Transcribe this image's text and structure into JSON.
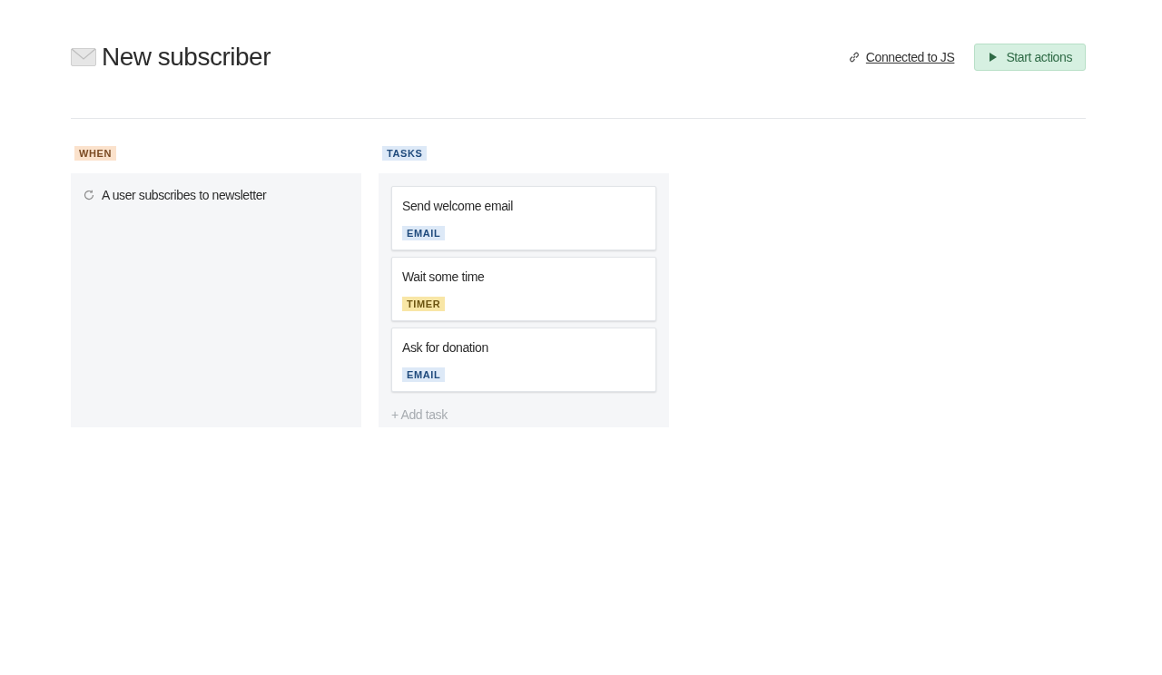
{
  "header": {
    "title": "New subscriber",
    "link": "Connected to JS",
    "button": "Start actions"
  },
  "columns": [
    {
      "kind": "trigger",
      "label": "WHEN",
      "items": [
        "A user subscribes to newsletter"
      ]
    },
    {
      "kind": "tasks",
      "label": "TASKS",
      "tasks": [
        {
          "title": "Send welcome email",
          "tag": "EMAIL",
          "kind": "email"
        },
        {
          "title": "Wait some time",
          "tag": "TIMER",
          "kind": "timer"
        },
        {
          "title": "Ask for donation",
          "tag": "EMAIL",
          "kind": "email"
        }
      ],
      "add": "+ Add task"
    }
  ]
}
